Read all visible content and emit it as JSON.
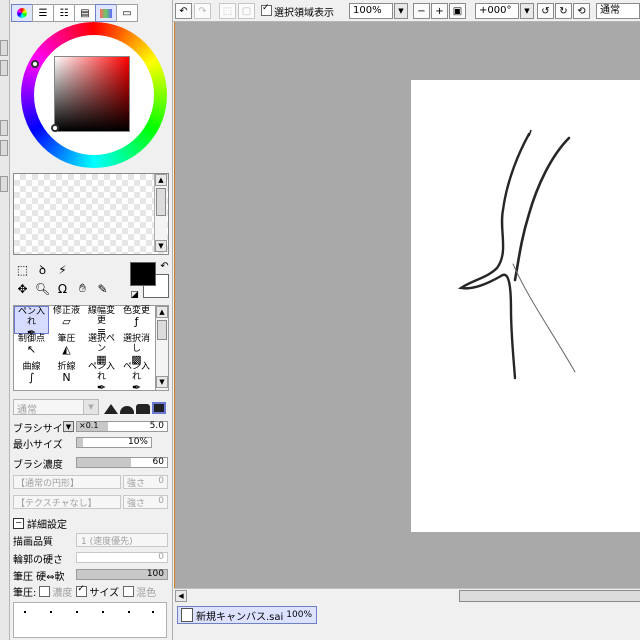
{
  "top_toolbar": {
    "show_selection_label": "選択領域表示",
    "zoom_value": "100%",
    "rotation_value": "+000°",
    "blend_mode_value": "通常"
  },
  "colors": {
    "foreground": "#000000",
    "background": "#ffffff",
    "canvas_background": "#a9a9a9",
    "selected_highlight": "#d6dcff"
  },
  "brushes": [
    {
      "label": "ペン入れ",
      "icon": "pen-icon"
    },
    {
      "label": "修正液",
      "icon": "correction-fluid-icon"
    },
    {
      "label": "線幅変更",
      "icon": "line-width-icon"
    },
    {
      "label": "色変更",
      "icon": "recolor-icon"
    },
    {
      "label": "制御点",
      "icon": "control-point-icon"
    },
    {
      "label": "筆圧",
      "icon": "pressure-icon"
    },
    {
      "label": "選択ペン",
      "icon": "select-pen-icon"
    },
    {
      "label": "選択消し",
      "icon": "select-erase-icon"
    },
    {
      "label": "曲線",
      "icon": "curve-icon"
    },
    {
      "label": "折線",
      "icon": "polyline-icon"
    },
    {
      "label": "ペン入れ",
      "icon": "pen-icon"
    },
    {
      "label": "ペン入れ",
      "icon": "pen-icon"
    }
  ],
  "params": {
    "blend_mode": "通常",
    "brush_size_label": "ブラシサイズ",
    "brush_size_multiplier": "×0.1",
    "brush_size_value": "5.0",
    "min_size_label": "最小サイズ",
    "min_size_value": "10%",
    "density_label": "ブラシ濃度",
    "density_value": "60",
    "shape_placeholder": "【通常の円形】",
    "shape_strength_label": "強さ",
    "shape_strength_value": "0",
    "texture_placeholder": "【テクスチャなし】",
    "texture_strength_label": "強さ",
    "texture_strength_value": "0",
    "details_label": "詳細設定",
    "quality_label": "描画品質",
    "quality_value": "1 (速度優先)",
    "edge_hardness_label": "輪郭の硬さ",
    "edge_hardness_value": "0",
    "pressure_label": "筆圧 硬⇔軟",
    "pressure_value": "100",
    "pressure_row_label": "筆圧:",
    "pressure_density_label": "濃度",
    "pressure_size_label": "サイズ",
    "pressure_blend_label": "混色"
  },
  "status": {
    "doc_name": "新規キャンバス.sai",
    "doc_zoom": "100%"
  }
}
